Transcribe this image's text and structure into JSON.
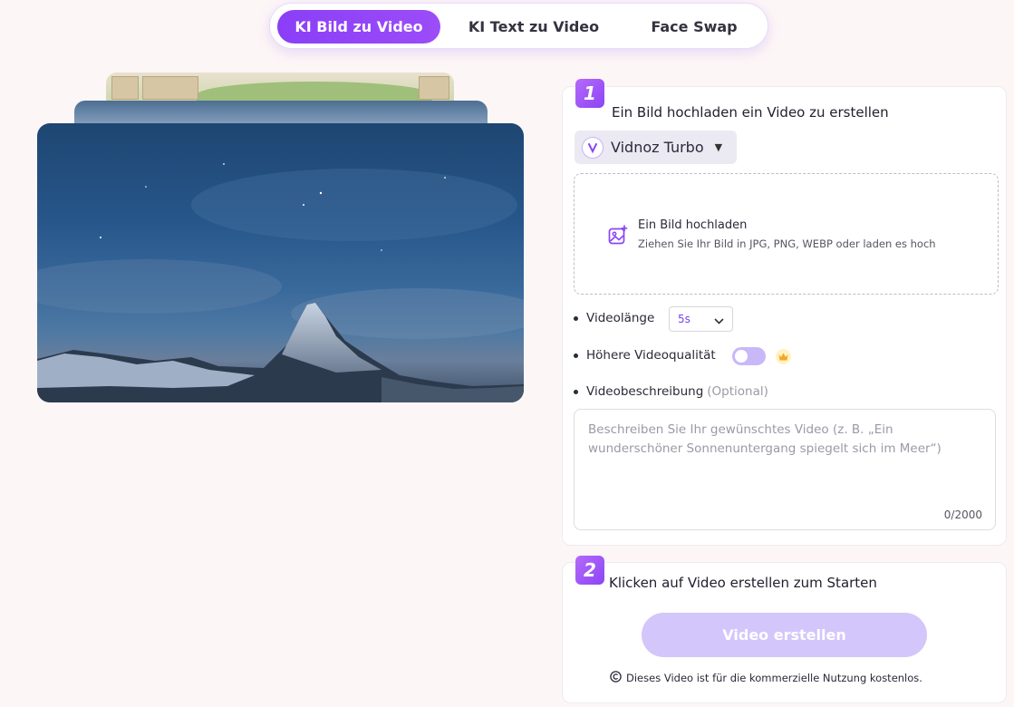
{
  "tabs": [
    {
      "label": "KI Bild zu Video",
      "active": true
    },
    {
      "label": "KI Text zu Video",
      "active": false
    },
    {
      "label": "Face Swap",
      "active": false
    }
  ],
  "step1": {
    "number": "1",
    "title": "Ein Bild hochladen ein Video zu erstellen",
    "model": {
      "label": "Vidnoz Turbo",
      "icon": "vidnoz-logo-icon"
    },
    "upload": {
      "title": "Ein Bild hochladen",
      "subtitle": "Ziehen Sie Ihr Bild in JPG, PNG, WEBP oder laden es hoch",
      "icon": "image-add-icon"
    },
    "duration": {
      "label": "Videolänge",
      "value": "5s"
    },
    "quality": {
      "label": "Höhere Videoqualität",
      "enabled": false,
      "badge_icon": "crown-icon"
    },
    "description": {
      "label": "Videobeschreibung",
      "hint": "(Optional)",
      "placeholder": "Beschreiben Sie Ihr gewünschtes Video (z. B. „Ein wunderschöner Sonnenuntergang spiegelt sich im Meer“)",
      "value": "",
      "counter": "0/2000"
    }
  },
  "step2": {
    "number": "2",
    "title": "Klicken auf Video erstellen zum Starten",
    "button_label": "Video erstellen",
    "license_text": "Dieses Video ist für die kommerzielle Nutzung kostenlos.",
    "license_icon": "copyright-icon"
  },
  "colors": {
    "accent": "#8a3ff7",
    "button_disabled": "#d3c6fb",
    "background": "#fdf6f6"
  }
}
